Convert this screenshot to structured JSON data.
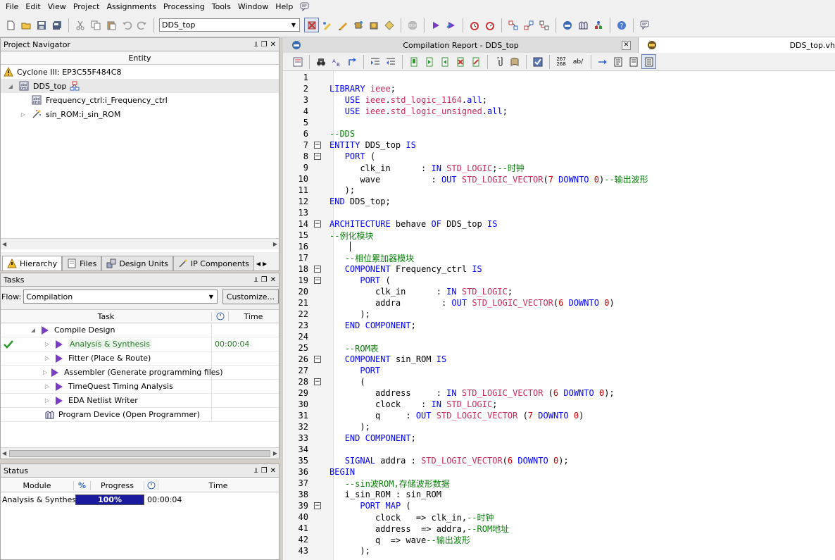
{
  "menu": [
    "File",
    "Edit",
    "View",
    "Project",
    "Assignments",
    "Processing",
    "Tools",
    "Window",
    "Help"
  ],
  "toolbar": {
    "entity_value": "DDS_top"
  },
  "project_navigator": {
    "title": "Project Navigator",
    "column": "Entity",
    "device": "Cyclone III: EP3C55F484C8",
    "top": "DDS_top",
    "children": [
      "Frequency_ctrl:i_Frequency_ctrl",
      "sin_ROM:i_sin_ROM"
    ],
    "tabs": [
      "Hierarchy",
      "Files",
      "Design Units",
      "IP Components"
    ]
  },
  "tasks": {
    "title": "Tasks",
    "flow_label": "Flow:",
    "flow_value": "Compilation",
    "customize": "Customize...",
    "col_task": "Task",
    "col_time": "Time",
    "rows": [
      {
        "name": "Compile Design",
        "time": ""
      },
      {
        "name": "Analysis & Synthesis",
        "time": "00:00:04"
      },
      {
        "name": "Fitter (Place & Route)",
        "time": ""
      },
      {
        "name": "Assembler (Generate programming files)",
        "time": ""
      },
      {
        "name": "TimeQuest Timing Analysis",
        "time": ""
      },
      {
        "name": "EDA Netlist Writer",
        "time": ""
      },
      {
        "name": "Program Device (Open Programmer)",
        "time": ""
      }
    ]
  },
  "status": {
    "title": "Status",
    "col_module": "Module",
    "col_progress": "Progress",
    "col_time": "Time",
    "percent_symbol": "%",
    "row": {
      "module": "Analysis & Synthesis",
      "progress_text": "100%",
      "progress": 1.0,
      "time": "00:00:04"
    }
  },
  "editor": {
    "tab_report": "Compilation Report - DDS_top",
    "tab_file": "DDS_top.vh",
    "tool_num_top": "267",
    "tool_num_bottom": "268",
    "tool_ab": "ab/",
    "lines": [
      "",
      "LIBRARY ieee;",
      "   USE ieee.std_logic_1164.all;",
      "   USE ieee.std_logic_unsigned.all;",
      "",
      "--DDS",
      "ENTITY DDS_top IS",
      "   PORT (",
      "      clk_in      : IN STD_LOGIC;--时钟",
      "      wave          : OUT STD_LOGIC_VECTOR(7 DOWNTO 0)--输出波形",
      "   );",
      "END DDS_top;",
      "",
      "ARCHITECTURE behave OF DDS_top IS",
      "--例化模块",
      "   ",
      "   --相位累加器模块",
      "   COMPONENT Frequency_ctrl IS",
      "      PORT (",
      "         clk_in      : IN STD_LOGIC;",
      "         addra        : OUT STD_LOGIC_VECTOR(6 DOWNTO 0)",
      "      );",
      "   END COMPONENT;",
      "",
      "   --ROM表",
      "   COMPONENT sin_ROM IS",
      "      PORT",
      "      (",
      "         address     : IN STD_LOGIC_VECTOR (6 DOWNTO 0);",
      "         clock    : IN STD_LOGIC;",
      "         q     : OUT STD_LOGIC_VECTOR (7 DOWNTO 0)",
      "      );",
      "   END COMPONENT;",
      "",
      "   SIGNAL addra : STD_LOGIC_VECTOR(6 DOWNTO 0);",
      "BEGIN",
      "   --sin波ROM,存储波形数据",
      "   i_sin_ROM : sin_ROM",
      "      PORT MAP (",
      "         clock   => clk_in,--时钟",
      "         address  => addra,--ROM地址",
      "         q  => wave--输出波形",
      "      );"
    ],
    "fold_lines": [
      7,
      8,
      14,
      18,
      19,
      26,
      28,
      39
    ]
  },
  "colors": {
    "keyword": "#0000ff",
    "type": "#cc2a5a",
    "comment": "#088008",
    "number": "#cc0000",
    "progress": "#1a1a9e",
    "task_icon": "#7a3cc4",
    "check": "#2a9a2a"
  }
}
